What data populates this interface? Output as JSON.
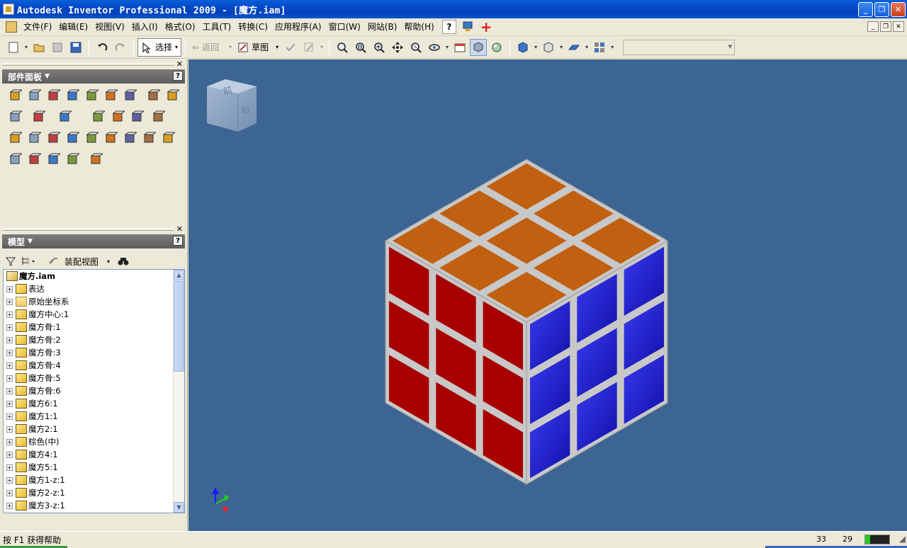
{
  "window": {
    "title": "Autodesk Inventor Professional 2009 - [魔方.iam]"
  },
  "menu": {
    "items": [
      "文件(F)",
      "编辑(E)",
      "视图(V)",
      "插入(I)",
      "格式(O)",
      "工具(T)",
      "转换(C)",
      "应用程序(A)",
      "窗口(W)",
      "网站(B)",
      "帮助(H)"
    ],
    "help_button": "?"
  },
  "toolbar": {
    "select_label": "选择",
    "return_label": "返回",
    "sketch_label": "草图"
  },
  "parts_panel": {
    "title": "部件面板",
    "help": "?",
    "icons": [
      "place-component-icon",
      "create-component-icon",
      "pattern-component-icon",
      "place-constraint-icon",
      "replace-component-icon",
      "mirror-component-icon",
      "copy-component-icon",
      "move-component-icon",
      "rotate-component-icon",
      "section-view-icon",
      "work-plane-icon",
      "work-axis-icon",
      "work-point-icon",
      "ucs-icon",
      "drive-constraint-icon",
      "extrude-icon",
      "sketch-icon",
      "work-point-feature-icon",
      "hole-icon",
      "fillet-icon",
      "shell-icon",
      "chamfer-icon",
      "split-icon",
      "feature-icon",
      "rectangular-pattern-icon",
      "circular-pattern-icon",
      "mirror-feature-icon",
      "parameters-icon",
      "materials-icon",
      "bom-icon"
    ]
  },
  "model_panel": {
    "title": "模型",
    "help": "?",
    "view_label": "装配视图",
    "tree": [
      {
        "label": "魔方.iam",
        "type": "root"
      },
      {
        "label": "表达",
        "type": "representation"
      },
      {
        "label": "原始坐标系",
        "type": "folder"
      },
      {
        "label": "魔方中心:1",
        "type": "part"
      },
      {
        "label": "魔方骨:1",
        "type": "part"
      },
      {
        "label": "魔方骨:2",
        "type": "part"
      },
      {
        "label": "魔方骨:3",
        "type": "part"
      },
      {
        "label": "魔方骨:4",
        "type": "part"
      },
      {
        "label": "魔方骨:5",
        "type": "part"
      },
      {
        "label": "魔方骨:6",
        "type": "part"
      },
      {
        "label": "魔方6:1",
        "type": "part"
      },
      {
        "label": "魔方1:1",
        "type": "part"
      },
      {
        "label": "魔方2:1",
        "type": "part"
      },
      {
        "label": "棕色(中)",
        "type": "part"
      },
      {
        "label": "魔方4:1",
        "type": "part"
      },
      {
        "label": "魔方5:1",
        "type": "part"
      },
      {
        "label": "魔方1-z:1",
        "type": "part"
      },
      {
        "label": "魔方2-z:1",
        "type": "part"
      },
      {
        "label": "魔方3-z:1",
        "type": "part"
      }
    ]
  },
  "viewport": {
    "background": "#3c6594",
    "viewcube_faces": [
      "前",
      "右"
    ],
    "cube_colors": {
      "top": "#c06010",
      "left": "#a80000",
      "right": "#2020c8",
      "gap": "#c8c8c8"
    }
  },
  "status": {
    "message": "按 F1 获得帮助",
    "count_a": "33",
    "count_b": "29",
    "progress": 0.22
  }
}
